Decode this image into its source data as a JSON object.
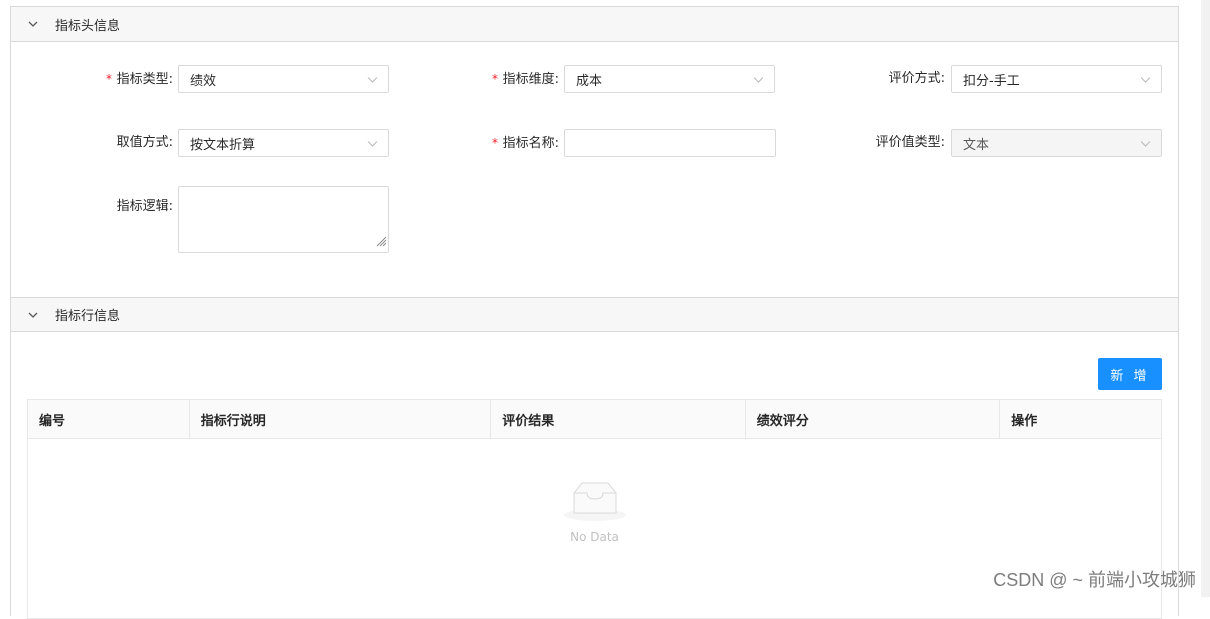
{
  "header_section": {
    "title": "指标头信息",
    "fields": {
      "indicator_type": {
        "label": "指标类型:",
        "required": true,
        "value": "绩效"
      },
      "indicator_dimension": {
        "label": "指标维度:",
        "required": true,
        "value": "成本"
      },
      "evaluation_method": {
        "label": "评价方式:",
        "required": false,
        "value": "扣分-手工"
      },
      "value_method": {
        "label": "取值方式:",
        "required": false,
        "value": "按文本折算"
      },
      "indicator_name": {
        "label": "指标名称:",
        "required": true,
        "value": "",
        "placeholder": ""
      },
      "evaluation_value_type": {
        "label": "评价值类型:",
        "required": false,
        "value": "文本",
        "disabled": true
      },
      "indicator_logic": {
        "label": "指标逻辑:",
        "required": false,
        "value": ""
      }
    }
  },
  "line_section": {
    "title": "指标行信息",
    "add_button": "新 增",
    "table": {
      "columns": [
        "编号",
        "指标行说明",
        "评价结果",
        "绩效评分",
        "操作"
      ],
      "rows": [],
      "empty_text": "No Data"
    }
  },
  "watermark": "CSDN @ ~ 前端小攻城狮",
  "colors": {
    "primary": "#1890ff",
    "required": "#f5222d",
    "header_bg": "#f7f7f7",
    "border": "#d9d9d9"
  }
}
